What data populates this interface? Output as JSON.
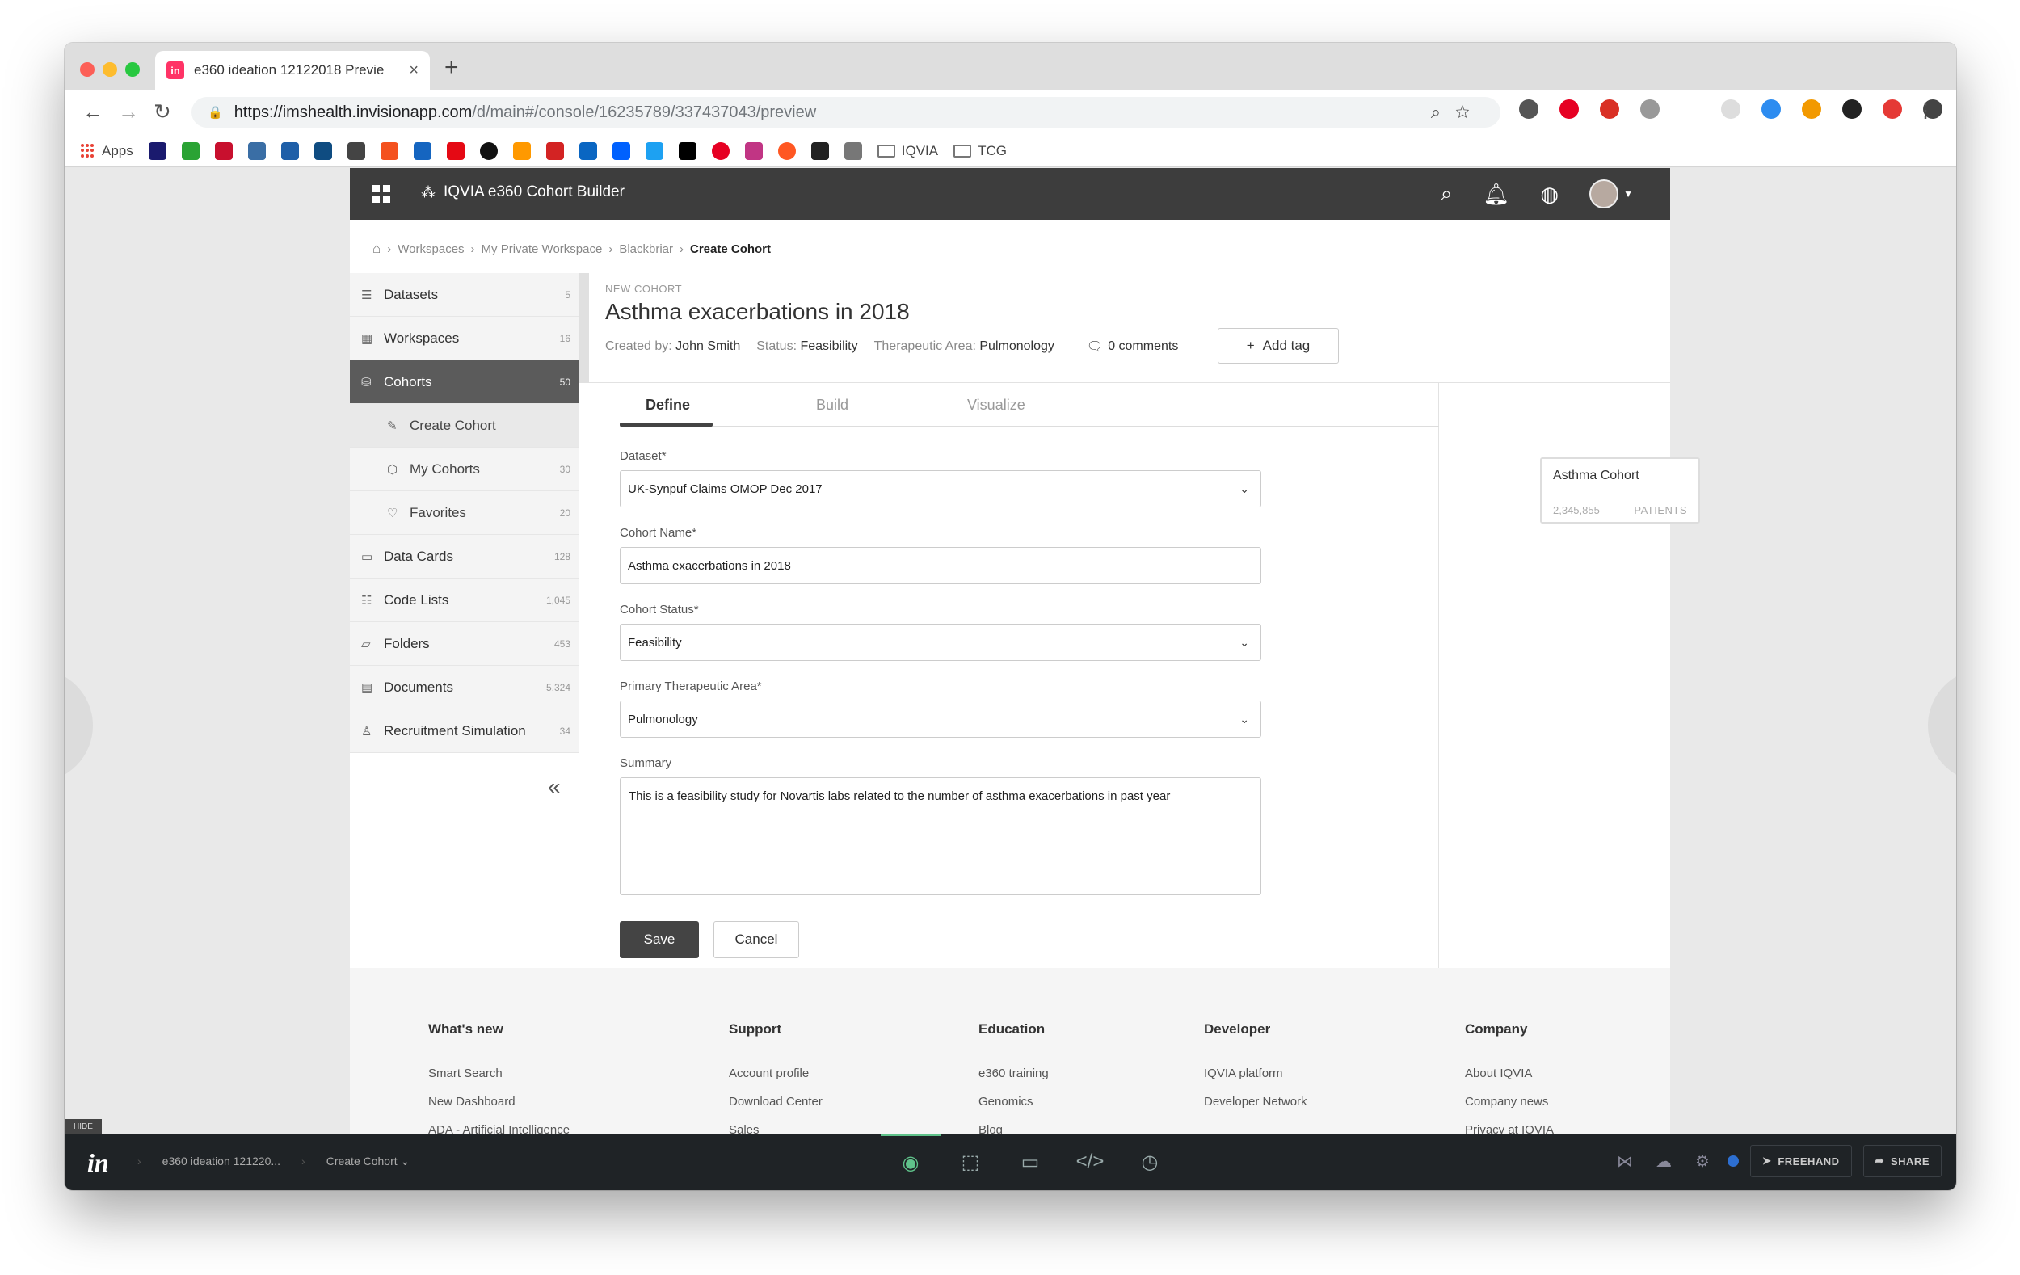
{
  "browser": {
    "tab_title": "e360 ideation 12122018 Previe",
    "tab_favicon": "in",
    "url_host": "https://imshealth.invisionapp.com",
    "url_path": "/d/main#/console/16235789/337437043/preview",
    "bookmarks_apps_label": "Apps",
    "bookmark_folders": [
      "IQVIA",
      "TCG"
    ]
  },
  "app": {
    "brand": "IQVIA e360 Cohort Builder",
    "breadcrumb": [
      "Workspaces",
      "My Private Workspace",
      "Blackbriar"
    ],
    "breadcrumb_current": "Create Cohort",
    "sidebar": {
      "items": [
        {
          "label": "Datasets",
          "count": "5",
          "icon": "database-icon"
        },
        {
          "label": "Workspaces",
          "count": "16",
          "icon": "workspace-icon"
        },
        {
          "label": "Cohorts",
          "count": "50",
          "icon": "cohort-icon"
        },
        {
          "label": "Create Cohort",
          "count": "",
          "icon": "pencil-icon"
        },
        {
          "label": "My Cohorts",
          "count": "30",
          "icon": "cube-icon"
        },
        {
          "label": "Favorites",
          "count": "20",
          "icon": "heart-icon"
        },
        {
          "label": "Data Cards",
          "count": "128",
          "icon": "card-icon"
        },
        {
          "label": "Code Lists",
          "count": "1,045",
          "icon": "list-icon"
        },
        {
          "label": "Folders",
          "count": "453",
          "icon": "folder-icon"
        },
        {
          "label": "Documents",
          "count": "5,324",
          "icon": "document-icon"
        },
        {
          "label": "Recruitment Simulation",
          "count": "34",
          "icon": "user-sim-icon"
        }
      ]
    },
    "header": {
      "eyebrow": "NEW COHORT",
      "title": "Asthma exacerbations in 2018",
      "created_by_label": "Created by:",
      "created_by": "John Smith",
      "status_label": "Status:",
      "status": "Feasibility",
      "area_label": "Therapeutic Area:",
      "area": "Pulmonology",
      "comments": "0 comments",
      "add_tag": "Add tag"
    },
    "tabs": [
      "Define",
      "Build",
      "Visualize"
    ],
    "form": {
      "dataset_label": "Dataset*",
      "dataset_value": "UK-Synpuf Claims OMOP Dec 2017",
      "name_label": "Cohort Name*",
      "name_value": "Asthma exacerbations in 2018",
      "status_label": "Cohort Status*",
      "status_value": "Feasibility",
      "area_label": "Primary Therapeutic Area*",
      "area_value": "Pulmonology",
      "summary_label": "Summary",
      "summary_value": "This is a feasibility study for Novartis labs related to the number of asthma exacerbations in past year",
      "save": "Save",
      "cancel": "Cancel"
    },
    "cohort_card": {
      "title": "Asthma Cohort",
      "count": "2,345,855",
      "unit": "PATIENTS"
    },
    "footer": [
      {
        "heading": "What's new",
        "links": [
          "Smart Search",
          "New Dashboard",
          "ADA - Artificial Intelligence"
        ]
      },
      {
        "heading": "Support",
        "links": [
          "Account profile",
          "Download Center",
          "Sales"
        ]
      },
      {
        "heading": "Education",
        "links": [
          "e360 training",
          "Genomics",
          "Blog"
        ]
      },
      {
        "heading": "Developer",
        "links": [
          "IQVIA platform",
          "Developer Network"
        ]
      },
      {
        "heading": "Company",
        "links": [
          "About IQVIA",
          "Company news",
          "Privacy at IQVIA"
        ]
      }
    ]
  },
  "invision": {
    "hide": "HIDE",
    "project": "e360 ideation 121220...",
    "screen": "Create Cohort",
    "freehand": "FREEHAND",
    "share": "SHARE"
  }
}
